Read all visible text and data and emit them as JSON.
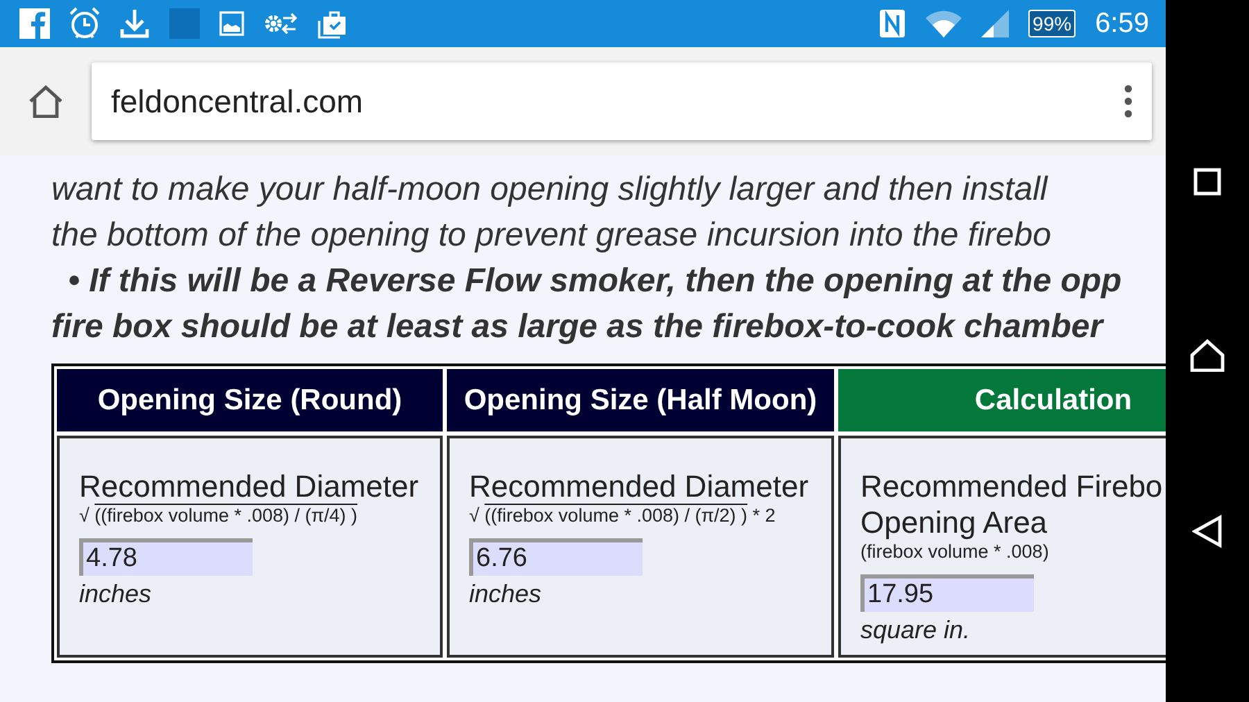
{
  "status_bar": {
    "battery": "99%",
    "time": "6:59"
  },
  "address_bar": {
    "url": "feldoncentral.com"
  },
  "article": {
    "lines": [
      {
        "text": "want to make your half-moon opening slightly larger and then install",
        "bold": false,
        "bullet": false
      },
      {
        "text": "the bottom of the opening to prevent grease incursion into the firebo",
        "bold": false,
        "bullet": false
      },
      {
        "text": "• If this will be a Reverse Flow smoker, then the opening at the opp",
        "bold": true,
        "bullet": true
      },
      {
        "text": "fire box should be at least as large as the firebox-to-cook chamber",
        "bold": true,
        "bullet": false
      }
    ]
  },
  "table": {
    "columns": [
      {
        "heading": "Opening Size (Round)",
        "color": "#000033"
      },
      {
        "heading": "Opening Size (Half Moon)",
        "color": "#000033"
      },
      {
        "heading": "Calculation",
        "color": "#04773a"
      }
    ],
    "cells": [
      {
        "title": "Recommended Diameter",
        "formula": {
          "kind": "root",
          "sign": "√",
          "text": "((firebox volume * .008) / (π/4) )"
        },
        "value": "4.78",
        "unit": "inches"
      },
      {
        "title": "Recommended Diameter",
        "formula": {
          "kind": "root",
          "sign": "√",
          "text": "((firebox volume * .008) / (π/2) )",
          "after": "* 2"
        },
        "value": "6.76",
        "unit": "inches"
      },
      {
        "title": "Recommended Firebo Opening Area",
        "formula": {
          "kind": "plain",
          "text": "(firebox volume * .008)"
        },
        "value": "17.95",
        "unit": "square in."
      }
    ]
  }
}
